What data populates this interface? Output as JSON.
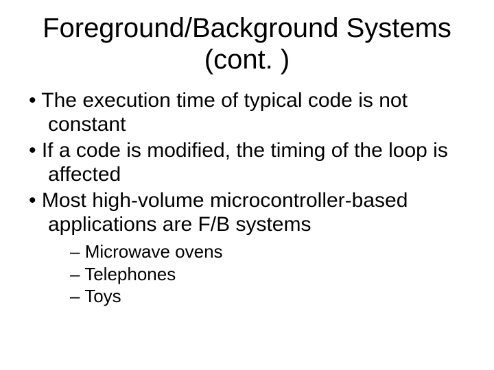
{
  "title": "Foreground/Background Systems (cont. )",
  "bullets": [
    "The execution time of typical code is not constant",
    "If a code is modified, the timing of the loop is affected",
    "Most high-volume microcontroller-based applications are F/B systems"
  ],
  "subbullets": [
    "Microwave ovens",
    "Telephones",
    "Toys"
  ]
}
